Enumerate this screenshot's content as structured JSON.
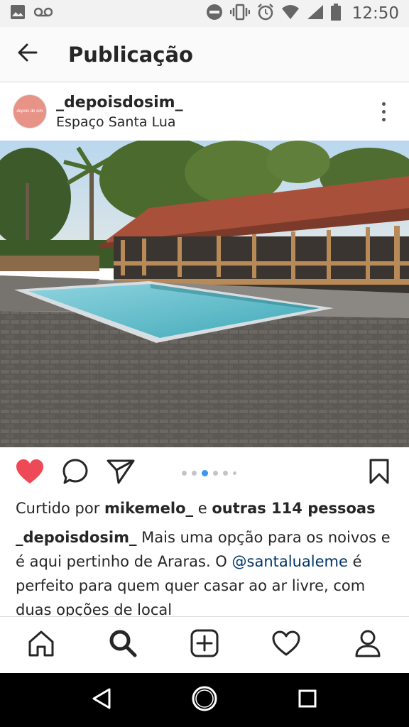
{
  "status_bar": {
    "time": "12:50",
    "left_icons": [
      "image-icon",
      "voicemail-icon"
    ],
    "right_icons": [
      "do-not-disturb-icon",
      "vibrate-icon",
      "alarm-icon",
      "wifi-icon",
      "signal-icon",
      "battery-icon"
    ]
  },
  "header": {
    "title": "Publicação",
    "back_icon": "arrow-back-icon"
  },
  "post": {
    "username": "_depoisdosim_",
    "location": "Espaço Santa Lua",
    "avatar_text": "depois do sim",
    "likes": {
      "prefix": "Curtido por",
      "liker": "mikemelo_",
      "joiner": "e",
      "others": "outras 114 pessoas"
    },
    "caption": {
      "author": "_depoisdosim_",
      "text_1": "Mais uma opção para os noivos e é aqui pertinho de Araras. O",
      "mention": "@santalualeme",
      "text_2": "é perfeito para quem quer casar ao ar livre, com duas opções de local"
    },
    "carousel": {
      "total": 6,
      "active_index": 2
    },
    "liked": true
  },
  "colors": {
    "like_red": "#ed4956",
    "dot_active": "#3897f0",
    "mention_blue": "#003569",
    "avatar_pink": "#e89388"
  },
  "bottom_nav": [
    "home-icon",
    "search-icon",
    "add-post-icon",
    "activity-heart-icon",
    "profile-icon"
  ],
  "system_nav": [
    "back-triangle-icon",
    "home-circle-icon",
    "recents-square-icon"
  ]
}
